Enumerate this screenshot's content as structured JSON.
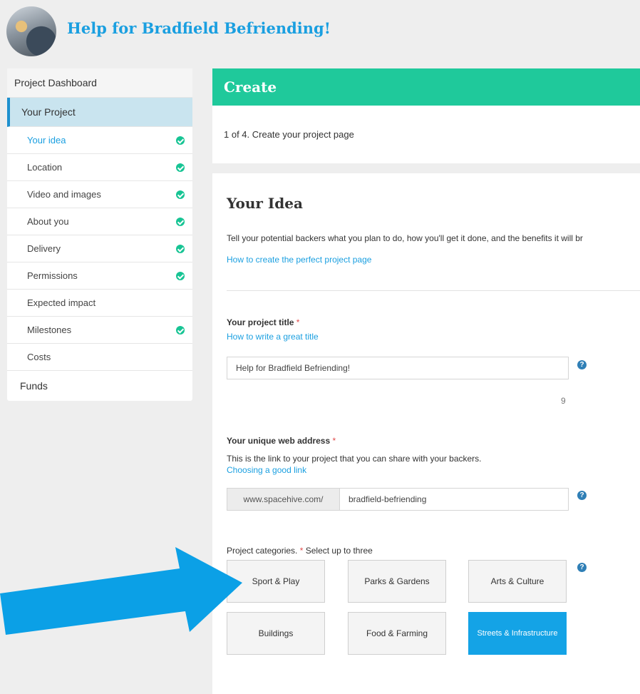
{
  "header": {
    "project_title": "Help for Bradfield Befriending!"
  },
  "sidebar": {
    "dashboard": "Project Dashboard",
    "your_project": "Your Project",
    "items": [
      {
        "label": "Your idea",
        "complete": true,
        "active": true
      },
      {
        "label": "Location",
        "complete": true
      },
      {
        "label": "Video and images",
        "complete": true
      },
      {
        "label": "About you",
        "complete": true
      },
      {
        "label": "Delivery",
        "complete": true
      },
      {
        "label": "Permissions",
        "complete": true
      },
      {
        "label": "Expected impact",
        "complete": false
      },
      {
        "label": "Milestones",
        "complete": true
      },
      {
        "label": "Costs",
        "complete": false
      }
    ],
    "funds": "Funds"
  },
  "main": {
    "create_heading": "Create",
    "step": "1 of 4. Create your project page",
    "section_title": "Your Idea",
    "intro": "Tell your potential backers what you plan to do, how you'll get it done, and the benefits it will br",
    "perfect_page_link": "How to create the perfect project page",
    "title_field": {
      "label": "Your project title",
      "required": "*",
      "help_link": "How to write a great title",
      "value": "Help for Bradfield Befriending!",
      "counter": "9"
    },
    "web_address": {
      "label": "Your unique web address",
      "required": "*",
      "description": "This is the link to your project that you can share with your backers.",
      "help_link": "Choosing a good link",
      "prefix": "www.spacehive.com/",
      "value": "bradfield-befriending"
    },
    "categories": {
      "label": "Project categories.",
      "required": "*",
      "hint": "Select up to three",
      "options": [
        {
          "label": "Sport & Play",
          "selected": false
        },
        {
          "label": "Parks & Gardens",
          "selected": false
        },
        {
          "label": "Arts & Culture",
          "selected": false
        },
        {
          "label": "Buildings",
          "selected": false
        },
        {
          "label": "Food & Farming",
          "selected": false
        },
        {
          "label": "Streets & Infrastructure",
          "selected": true
        }
      ]
    },
    "help_glyph": "?"
  },
  "colors": {
    "accent": "#1a9fe0",
    "create_bar": "#1fc99b",
    "check": "#17c494",
    "arrow": "#0ba0e6"
  },
  "icons": {
    "complete": "check-circle-icon",
    "help": "question-circle-icon",
    "pointer": "arrow-right-icon"
  }
}
